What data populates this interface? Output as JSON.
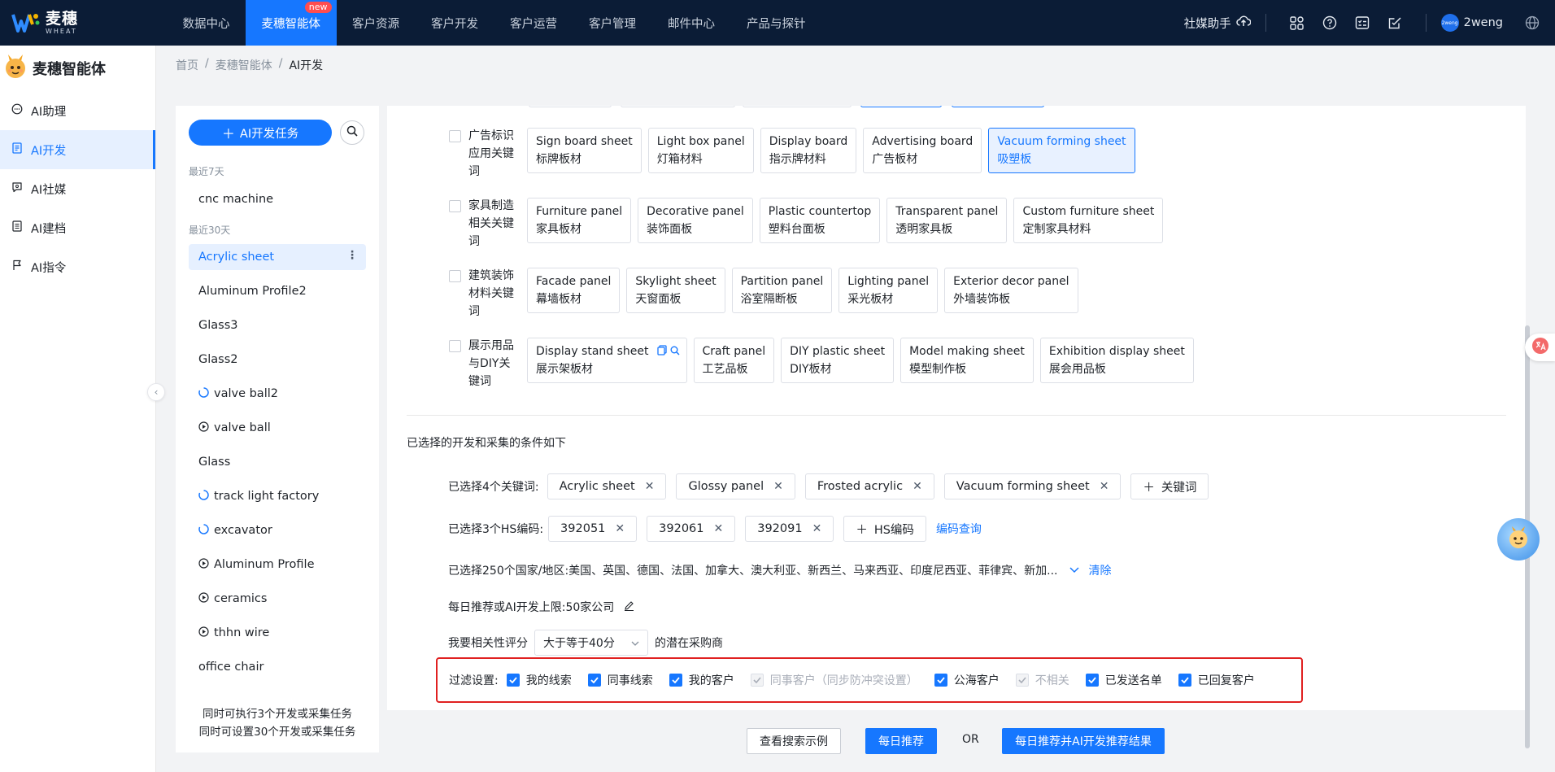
{
  "brand": {
    "name_cn": "麦穗",
    "name_en": "WHEAT"
  },
  "nav": {
    "items": [
      {
        "label": "数据中心"
      },
      {
        "label": "麦穗智能体",
        "badge": "new"
      },
      {
        "label": "客户资源"
      },
      {
        "label": "客户开发"
      },
      {
        "label": "客户运营"
      },
      {
        "label": "客户管理"
      },
      {
        "label": "邮件中心"
      },
      {
        "label": "产品与探针"
      }
    ]
  },
  "topright": {
    "assistant": "社媒助手",
    "username": "2weng",
    "avatar_text": "2weng"
  },
  "sidebar": {
    "title": "麦穗智能体",
    "items": [
      {
        "label": "AI助理",
        "icon": "chat-icon"
      },
      {
        "label": "AI开发",
        "icon": "document-icon"
      },
      {
        "label": "AI社媒",
        "icon": "chat-bubble-icon"
      },
      {
        "label": "AI建档",
        "icon": "file-list-icon"
      },
      {
        "label": "AI指令",
        "icon": "flag-icon"
      }
    ]
  },
  "breadcrumb": {
    "home": "首页",
    "section": "麦穗智能体",
    "current": "AI开发"
  },
  "tasks": {
    "add_label": "AI开发任务",
    "group_7days": "最近7天",
    "group_30days": "最近30天",
    "recent7": [
      {
        "label": "cnc machine"
      }
    ],
    "recent30": [
      {
        "label": "Acrylic sheet"
      },
      {
        "label": "Aluminum Profile2"
      },
      {
        "label": "Glass3"
      },
      {
        "label": "Glass2"
      },
      {
        "label": "valve ball2"
      },
      {
        "label": "valve ball"
      },
      {
        "label": "Glass"
      },
      {
        "label": "track light factory"
      },
      {
        "label": "excavator"
      },
      {
        "label": "Aluminum Profile"
      },
      {
        "label": "ceramics"
      },
      {
        "label": "thhn wire"
      },
      {
        "label": "office chair"
      }
    ],
    "footer1": "同时可执行3个开发或采集任务",
    "footer2": "同时可设置30个开发或采集任务"
  },
  "categories": [
    {
      "label": "广告标识应用关键词",
      "keywords": [
        {
          "en": "Sign board sheet",
          "zh": "标牌板材"
        },
        {
          "en": "Light box panel",
          "zh": "灯箱材料"
        },
        {
          "en": "Display board",
          "zh": "指示牌材料"
        },
        {
          "en": "Advertising board",
          "zh": "广告板材"
        },
        {
          "en": "Vacuum forming sheet",
          "zh": "吸塑板"
        }
      ]
    },
    {
      "label": "家具制造相关关键词",
      "keywords": [
        {
          "en": "Furniture panel",
          "zh": "家具板材"
        },
        {
          "en": "Decorative panel",
          "zh": "装饰面板"
        },
        {
          "en": "Plastic countertop",
          "zh": "塑料台面板"
        },
        {
          "en": "Transparent panel",
          "zh": "透明家具板"
        },
        {
          "en": "Custom furniture sheet",
          "zh": "定制家具材料"
        }
      ]
    },
    {
      "label": "建筑装饰材料关键词",
      "keywords": [
        {
          "en": "Facade panel",
          "zh": "幕墙板材"
        },
        {
          "en": "Skylight sheet",
          "zh": "天窗面板"
        },
        {
          "en": "Partition panel",
          "zh": "浴室隔断板"
        },
        {
          "en": "Lighting panel",
          "zh": "采光板材"
        },
        {
          "en": "Exterior decor panel",
          "zh": "外墙装饰板"
        }
      ]
    },
    {
      "label": "展示用品与DIY关键词",
      "keywords": [
        {
          "en": "Display stand sheet",
          "zh": "展示架板材"
        },
        {
          "en": "Craft panel",
          "zh": "工艺品板"
        },
        {
          "en": "DIY plastic sheet",
          "zh": "DIY板材"
        },
        {
          "en": "Model making sheet",
          "zh": "模型制作板"
        },
        {
          "en": "Exhibition display sheet",
          "zh": "展会用品板"
        }
      ]
    }
  ],
  "conditions": {
    "section_title": "已选择的开发和采集的条件如下",
    "keywords_label": "已选择4个关键词:",
    "keywords": [
      "Acrylic sheet",
      "Glossy panel",
      "Frosted acrylic",
      "Vacuum forming sheet"
    ],
    "add_keyword": "关键词",
    "hs_label": "已选择3个HS编码:",
    "hs_codes": [
      "392051",
      "392061",
      "392091"
    ],
    "add_hs": "HS编码",
    "hs_lookup": "编码查询",
    "countries_label": "已选择250个国家/地区:",
    "countries_value": "美国、英国、德国、法国、加拿大、澳大利亚、新西兰、马来西亚、印度尼西亚、菲律宾、新加...",
    "clear": "清除",
    "daily_limit_label": "每日推荐或AI开发上限:",
    "daily_limit_value": "50家公司",
    "score_prefix": "我要相关性评分",
    "score_select": "大于等于40分",
    "score_suffix": "的潜在采购商",
    "filter_label": "过滤设置:",
    "filters": [
      {
        "label": "我的线索",
        "checked": true,
        "disabled": false
      },
      {
        "label": "同事线索",
        "checked": true,
        "disabled": false
      },
      {
        "label": "我的客户",
        "checked": true,
        "disabled": false
      },
      {
        "label": "同事客户（同步防冲突设置）",
        "checked": true,
        "disabled": true
      },
      {
        "label": "公海客户",
        "checked": true,
        "disabled": false
      },
      {
        "label": "不相关",
        "checked": true,
        "disabled": true
      },
      {
        "label": "已发送名单",
        "checked": true,
        "disabled": false
      },
      {
        "label": "已回复客户",
        "checked": true,
        "disabled": false
      }
    ]
  },
  "actions": {
    "example": "查看搜索示例",
    "daily": "每日推荐",
    "or": "OR",
    "daily_ai": "每日推荐并AI开发推荐结果"
  },
  "colors": {
    "primary": "#1677ff",
    "nav_bg": "#0b1c36",
    "highlight": "#e02020"
  }
}
